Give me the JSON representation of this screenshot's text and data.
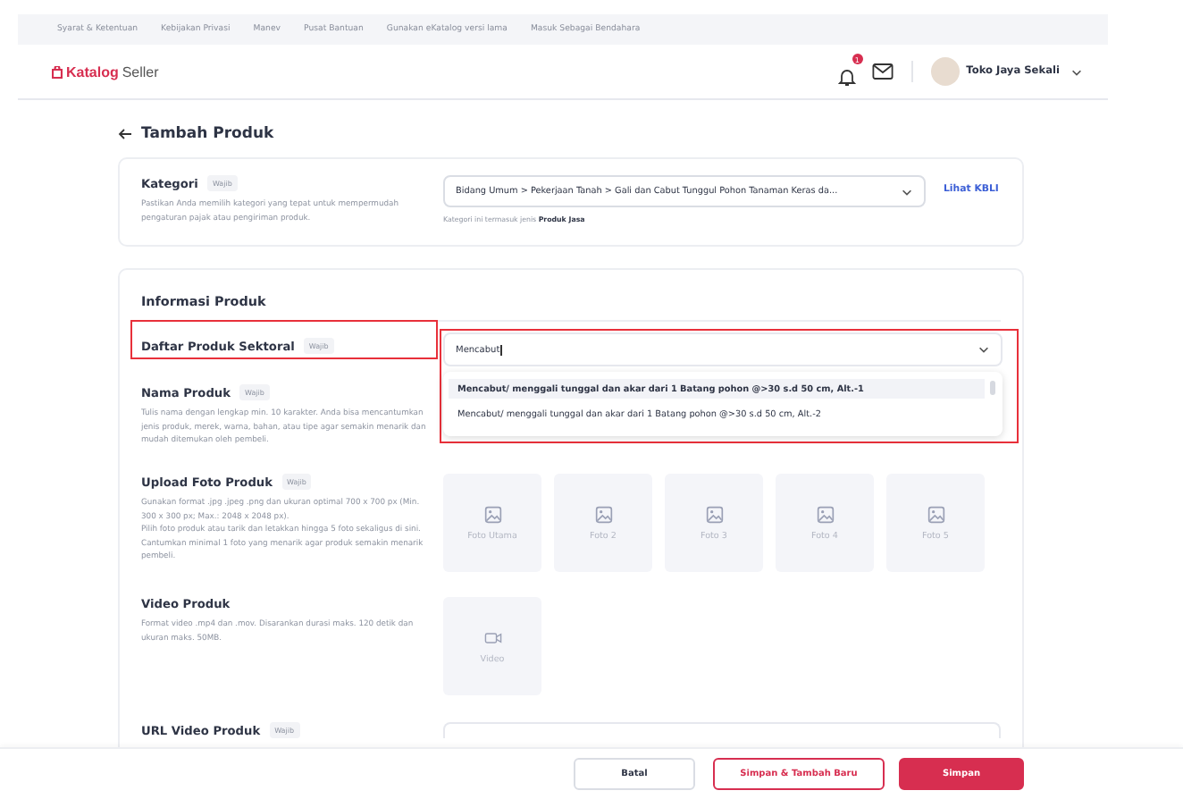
{
  "top_links": [
    "Syarat & Ketentuan",
    "Kebijakan Privasi",
    "Manev",
    "Pusat Bantuan",
    "Gunakan eKatalog versi lama",
    "Masuk Sebagai Bendahara"
  ],
  "header": {
    "logo": "Katalog",
    "logo_suffix": "Seller",
    "notification_count": "1",
    "user_name": "Toko Jaya Sekali"
  },
  "page_title": "Tambah Produk",
  "kategori": {
    "label": "Kategori",
    "badge": "Wajib",
    "description": "Pastikan Anda memilih kategori yang tepat untuk mempermudah pengaturan pajak atau pengiriman produk.",
    "value": "Bidang Umum > Pekerjaan Tanah > Gali dan Cabut Tunggul Pohon Tanaman Keras da...",
    "hint": "Kategori ini termasuk jenis **Produk Jasa**",
    "link": "Lihat KBLI"
  },
  "informasi": {
    "title": "Informasi Produk",
    "fields": [
      {
        "kind": "dropdown",
        "label": "Daftar Produk Sektoral",
        "badge": "Wajib",
        "highlighted": true,
        "value": "Mencabut",
        "options": [
          {
            "label": "Mencabut/ menggali tunggal dan akar dari 1 Batang pohon @>30 s.d 50 cm, Alt.-1",
            "selected": true
          },
          {
            "label": "Mencabut/ menggali tunggal dan akar dari 1 Batang pohon @>30 s.d 50 cm, Alt.-2",
            "selected": false
          }
        ]
      },
      {
        "kind": "text",
        "label": "Nama Produk",
        "badge": "Wajib",
        "highlighted": false,
        "description": [
          "Tulis nama dengan lengkap min. 10 karakter. Anda bisa mencantumkan jenis produk, merek, warna, bahan, atau tipe agar semakin menarik dan mudah ditemukan oleh pembeli."
        ]
      },
      {
        "kind": "photos",
        "label": "Upload Foto Produk",
        "badge": "Wajib",
        "highlighted": false,
        "description": [
          "Gunakan format .jpg .jpeg .png dan ukuran optimal 700 x 700 px (Min. 300 x 300 px; Max.: 2048 x 2048 px).",
          "Pilih foto produk atau tarik dan letakkan hingga 5 foto sekaligus di sini. Cantumkan minimal 1 foto yang menarik agar produk semakin menarik pembeli."
        ],
        "tiles": [
          "Foto Utama",
          "Foto 2",
          "Foto 3",
          "Foto 4",
          "Foto 5"
        ]
      },
      {
        "kind": "video",
        "label": "Video Produk",
        "highlighted": false,
        "description": [
          "Format video .mp4 dan .mov. Disarankan durasi maks. 120 detik dan ukuran maks. 50MB."
        ],
        "tiles": [
          "Video"
        ]
      },
      {
        "kind": "url",
        "label": "URL Video Produk",
        "badge": "Wajib",
        "highlighted": false
      }
    ]
  },
  "footer_buttons": [
    {
      "kind": "secondary",
      "label": "Batal"
    },
    {
      "kind": "outline",
      "label": "Simpan & Tambah Baru"
    },
    {
      "kind": "primary",
      "label": "Simpan"
    }
  ]
}
